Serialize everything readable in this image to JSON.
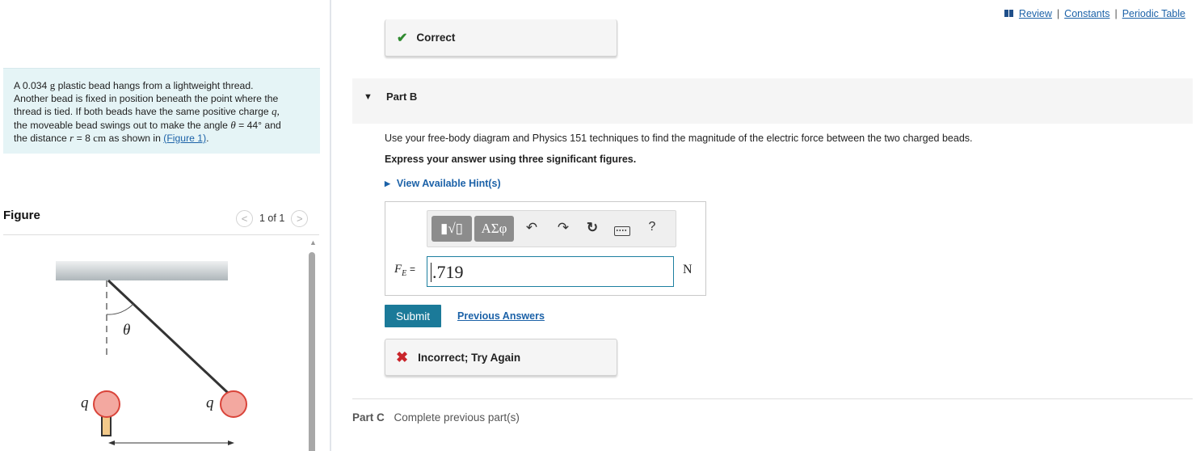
{
  "top_links": {
    "review": "Review",
    "constants": "Constants",
    "periodic_table": "Periodic Table",
    "sep": "|"
  },
  "problem": {
    "line1_a": "A 0.034",
    "line1_unit": "g",
    "line1_b": "plastic bead hangs from a lightweight thread.",
    "line2": "Another bead is fixed in position beneath the point where the",
    "line3_a": "thread is tied. If both beads have the same positive charge",
    "line3_q": "q,",
    "line4_a": "the moveable bead swings out to make the angle",
    "line4_theta": "θ",
    "line4_b": "= 44° and",
    "line5_a": "the distance",
    "line5_r": "r",
    "line5_b": "= 8",
    "line5_unit": "cm",
    "line5_c": "as shown in",
    "figure_link": "(Figure 1)",
    "line5_end": "."
  },
  "figure": {
    "title": "Figure",
    "pager": "1 of 1",
    "prev": "<",
    "next": ">",
    "theta_label": "θ",
    "charge_left": "q",
    "charge_right": "q"
  },
  "feedback_correct": {
    "label": "Correct",
    "icon": "check-icon"
  },
  "part_b": {
    "label": "Part B",
    "question": "Use your free-body diagram and Physics 151 techniques to find the magnitude of the electric force between the two charged beads.",
    "instruction": "Express your answer using three significant figures.",
    "hints": "View Available Hint(s)"
  },
  "toolbar": {
    "templates": "▮√▯",
    "symbols": "ΑΣφ",
    "undo": "↶",
    "redo": "↷",
    "reset": "↻",
    "help": "?"
  },
  "answer": {
    "label_main": "F",
    "label_sub": "E",
    "label_eq": "=",
    "value": ".719",
    "unit": "N"
  },
  "submit_label": "Submit",
  "previous_answers": "Previous Answers",
  "feedback_incorrect": {
    "label": "Incorrect; Try Again",
    "icon": "x-icon"
  },
  "part_c": {
    "label": "Part C",
    "text": "Complete previous part(s)"
  }
}
